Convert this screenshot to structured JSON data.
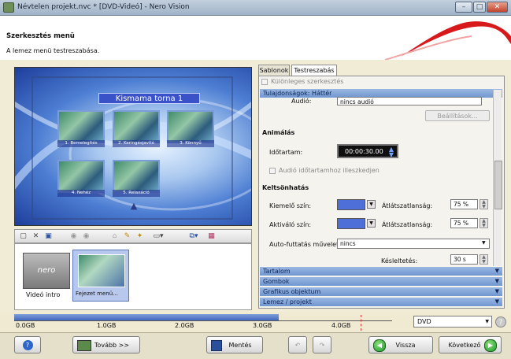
{
  "window": {
    "title": "Névtelen projekt.nvc * [DVD-Videó] - Nero Vision",
    "minimize": "–",
    "maximize": "□",
    "close": "✕"
  },
  "header": {
    "title": "Szerkesztés menü",
    "subtitle": "A lemez menü testreszabása."
  },
  "preview": {
    "menu_title": "Kismama torna 1",
    "thumbnails": [
      "1. Bemelegítés",
      "2. Keringésjavító",
      "3. Könnyű",
      "4. Nehéz",
      "5. Relaxáció"
    ]
  },
  "toolbar": {
    "icons": [
      "new-icon",
      "delete-icon",
      "save-icon",
      "prev-icon",
      "next-icon",
      "text-icon",
      "wand-icon",
      "effect-icon",
      "layout-icon",
      "layers-icon",
      "grid-icon"
    ]
  },
  "clips": {
    "items": [
      {
        "label": "Videó intro",
        "thumb_text": "nero"
      },
      {
        "label": "Fejezet menü..."
      }
    ]
  },
  "tabs": [
    "Sablonok",
    "Testreszabás"
  ],
  "panel": {
    "special_edit_label": "Különleges szerkesztés",
    "section_properties": "Tulajdonságok: Háttér",
    "audio_label": "Audió:",
    "audio_value": "nincs audió",
    "settings_button": "Beállítások...",
    "animation_heading": "Animálás",
    "duration_label": "Időtartam:",
    "duration_value": "00:00:30.00",
    "audio_duration_checkbox": "Audió időtartamhoz illeszkedjen",
    "border_effect_heading": "Keltsönhatás",
    "highlight_color_label": "Kiemelő szín:",
    "active_color_label": "Aktiváló szín:",
    "transparency_label_1": "Átlátszatlanság:",
    "transparency_value_1": "75 %",
    "transparency_label_2": "Átlátszatlanság:",
    "transparency_value_2": "75 %",
    "autorun_label": "Auto-futtatás művelet:",
    "autorun_value": "nincs",
    "delay_label": "Késleltetés:",
    "delay_value": "30 s",
    "sections": [
      "Tartalom",
      "Gombok",
      "Grafikus objektum",
      "Lemez / projekt"
    ]
  },
  "disk": {
    "labels": [
      "0.0GB",
      "1.0GB",
      "2.0GB",
      "3.0GB",
      "4.0GB"
    ],
    "usage_fraction": 0.56,
    "format": "DVD"
  },
  "bottom": {
    "help": "?",
    "more": "Tovább >>",
    "save": "Mentés",
    "back": "Vissza",
    "next": "Következő"
  },
  "colors": {
    "accent": "#7096d0",
    "swatch": "#4f6fd8",
    "disk_fill": "#3c62bb",
    "ok_green": "#1b9b2b"
  }
}
